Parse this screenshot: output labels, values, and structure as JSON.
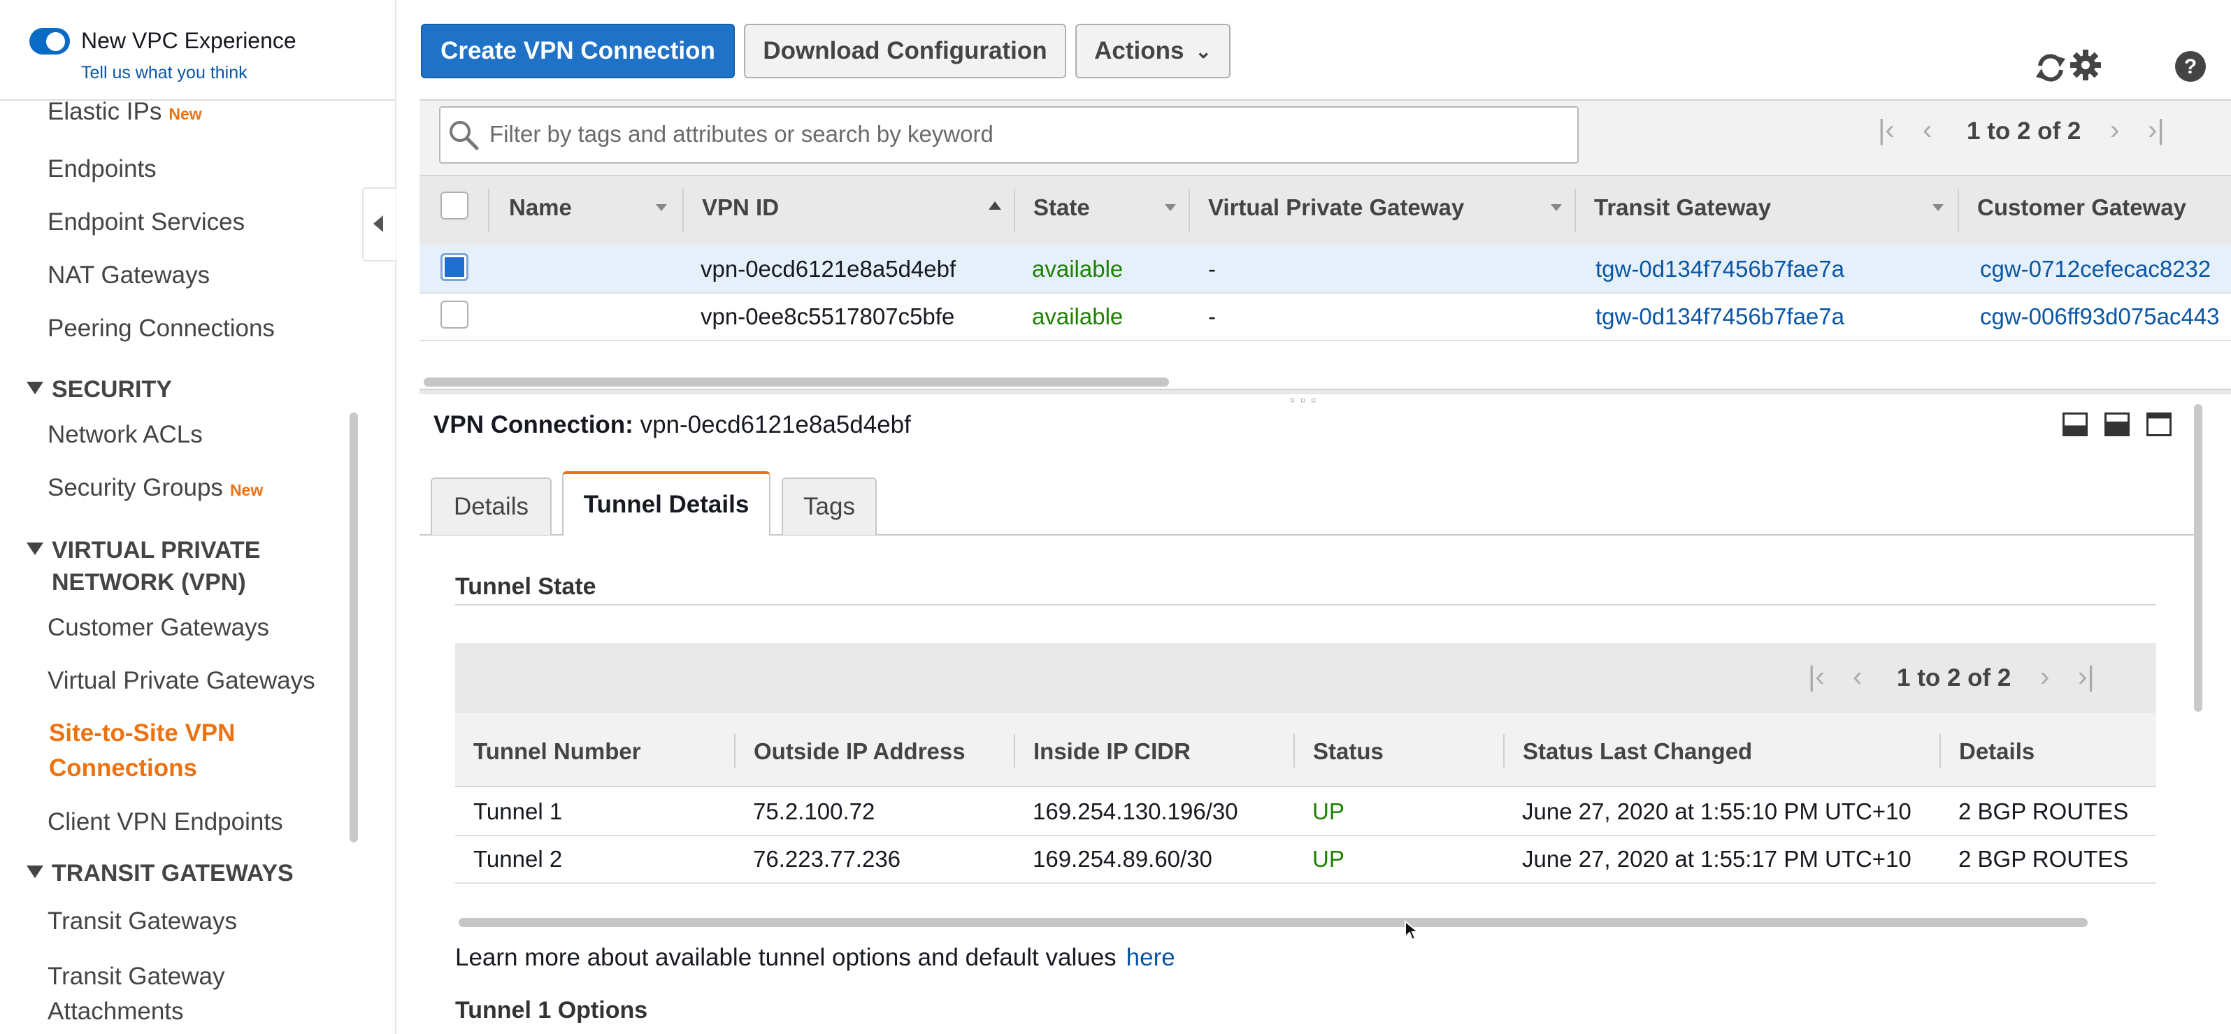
{
  "sidebar": {
    "toggle_label": "New VPC Experience",
    "feedback_link": "Tell us what you think",
    "items": {
      "elastic_ips": "Elastic IPs",
      "elastic_ips_badge": "New",
      "endpoints": "Endpoints",
      "endpoint_services": "Endpoint Services",
      "nat_gateways": "NAT Gateways",
      "peering": "Peering Connections",
      "network_acls": "Network ACLs",
      "security_groups": "Security Groups",
      "security_groups_badge": "New",
      "customer_gateways": "Customer Gateways",
      "virtual_private_gateways": "Virtual Private Gateways",
      "s2s_line1": "Site-to-Site VPN",
      "s2s_line2": "Connections",
      "client_vpn": "Client VPN Endpoints",
      "transit_gateways": "Transit Gateways",
      "tga_line1": "Transit Gateway",
      "tga_line2": "Attachments"
    },
    "sections": {
      "security": "SECURITY",
      "vpn_line1": "VIRTUAL PRIVATE",
      "vpn_line2": "NETWORK (VPN)",
      "transit": "TRANSIT GATEWAYS"
    }
  },
  "toolbar": {
    "create": "Create VPN Connection",
    "download": "Download Configuration",
    "actions": "Actions"
  },
  "icons": {
    "refresh": "refresh-icon",
    "settings": "gear-icon",
    "help": "help-icon"
  },
  "filter": {
    "placeholder": "Filter by tags and attributes or search by keyword",
    "pager": "1 to 2 of 2"
  },
  "vpn_table": {
    "columns": [
      "Name",
      "VPN ID",
      "State",
      "Virtual Private Gateway",
      "Transit Gateway",
      "Customer Gateway"
    ],
    "rows": [
      {
        "name": "",
        "vpn_id": "vpn-0ecd6121e8a5d4ebf",
        "state": "available",
        "vgw": "-",
        "tgw": "tgw-0d134f7456b7fae7a",
        "cgw": "cgw-0712cefecac8232",
        "selected": true
      },
      {
        "name": "",
        "vpn_id": "vpn-0ee8c5517807c5bfe",
        "state": "available",
        "vgw": "-",
        "tgw": "tgw-0d134f7456b7fae7a",
        "cgw": "cgw-006ff93d075ac443",
        "selected": false
      }
    ]
  },
  "details": {
    "label": "VPN Connection:",
    "vpn_id": "vpn-0ecd6121e8a5d4ebf",
    "tabs": [
      "Details",
      "Tunnel Details",
      "Tags"
    ],
    "active_tab": "Tunnel Details",
    "tunnel_state_title": "Tunnel State",
    "pager": "1 to 2 of 2",
    "columns": [
      "Tunnel Number",
      "Outside IP Address",
      "Inside IP CIDR",
      "Status",
      "Status Last Changed",
      "Details"
    ],
    "rows": [
      {
        "tunnel": "Tunnel 1",
        "outside_ip": "75.2.100.72",
        "inside_cidr": "169.254.130.196/30",
        "status": "UP",
        "changed": "June 27, 2020 at 1:55:10 PM UTC+10",
        "details": "2 BGP ROUTES"
      },
      {
        "tunnel": "Tunnel 2",
        "outside_ip": "76.223.77.236",
        "inside_cidr": "169.254.89.60/30",
        "status": "UP",
        "changed": "June 27, 2020 at 1:55:17 PM UTC+10",
        "details": "2 BGP ROUTES"
      }
    ],
    "learn_more": "Learn more about available tunnel options and default values",
    "learn_link": "here",
    "tunnel1_options": "Tunnel 1 Options"
  },
  "colors": {
    "primary": "#1f72c6",
    "accent": "#ec7211",
    "success": "#1d8102",
    "link": "#0a56a4"
  }
}
